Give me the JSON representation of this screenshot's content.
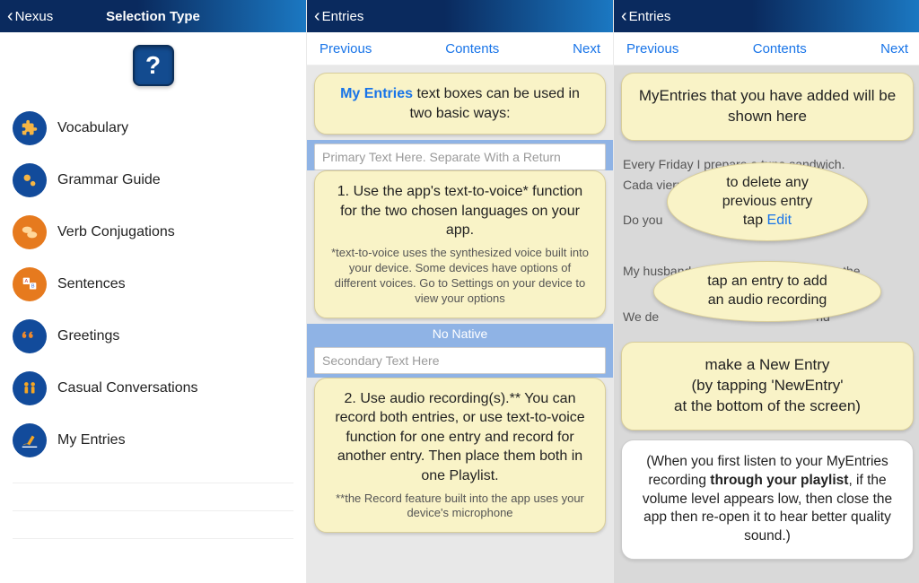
{
  "phone1": {
    "back": "Nexus",
    "title": "Selection Type",
    "help": "?",
    "menu": [
      {
        "label": "Vocabulary"
      },
      {
        "label": "Grammar Guide"
      },
      {
        "label": "Verb Conjugations"
      },
      {
        "label": "Sentences"
      },
      {
        "label": "Greetings"
      },
      {
        "label": "Casual Conversations"
      },
      {
        "label": "My Entries"
      }
    ]
  },
  "phone2": {
    "back": "Entries",
    "prev": "Previous",
    "contents": "Contents",
    "next": "Next",
    "intro_blue": "My Entries",
    "intro_rest": " text boxes can be used in two basic ways:",
    "primary_ph": "Primary Text Here. Separate With a Return",
    "card1_main": "1. Use the app's text-to-voice* function for the two chosen languages on your app.",
    "card1_foot": "*text-to-voice uses the synthesized voice built into your device. Some devices have options of different voices. Go to Settings on your device to view your options",
    "no_native": "No Native",
    "secondary_ph": "Secondary Text Here",
    "card2_main": "2. Use audio recording(s).** You can record both entries, or use text-to-voice function for one entry and record for another entry. Then place them both in one Playlist.",
    "card2_foot": "**the Record feature built into the app uses your device's microphone"
  },
  "phone3": {
    "back": "Entries",
    "prev": "Previous",
    "contents": "Contents",
    "next": "Next",
    "intro": "MyEntries that you have added will be shown here",
    "bg_line1": "Every Friday I prepare a tuna sandwich.",
    "bg_line2": "Cada viernes preparo un bocadillo de a...",
    "bg_line3": "Do you ",
    "bg_line4": "My husband                               leaving the",
    "bg_line5": "We de                                             nd",
    "oval1a": "to delete any",
    "oval1b": "previous entry",
    "oval1c_prefix": "tap ",
    "oval1c_link": "Edit",
    "oval2a": "tap an entry to add",
    "oval2b": "an audio recording",
    "card_make": "make a New Entry\n(by tapping 'NewEntry'\nat the bottom of the screen)",
    "white1": "(When you first listen to your MyEntries recording ",
    "white_bold": "through your playlist",
    "white2": ", if the volume level appears low, then close the app then re-open it to hear better quality sound.)"
  }
}
